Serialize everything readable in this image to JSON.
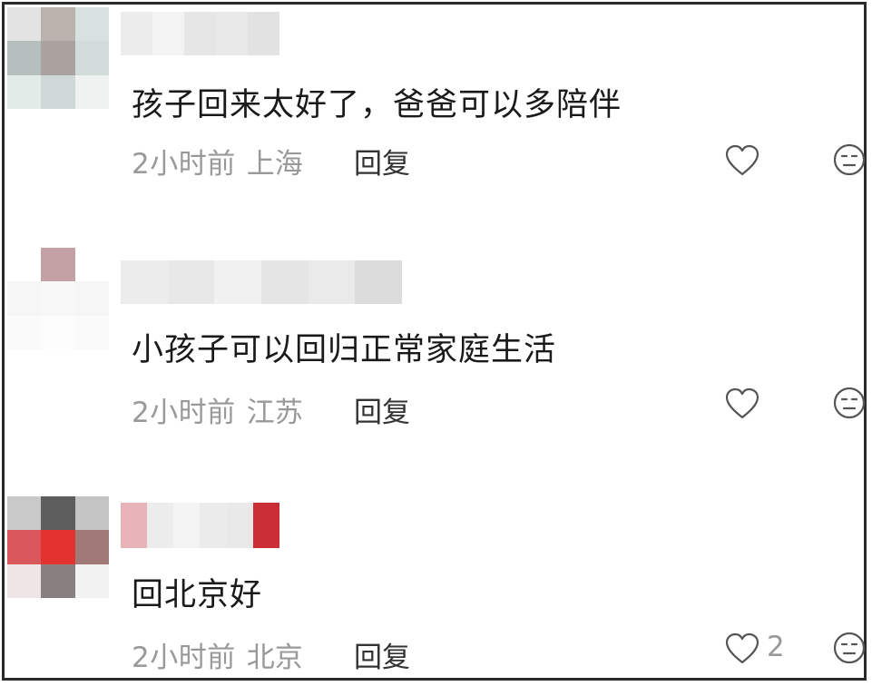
{
  "comments": [
    {
      "text": "孩子回来太好了，爸爸可以多陪伴",
      "time": "2小时前",
      "location": "上海",
      "reply_label": "回复",
      "like_count": "",
      "like_icon": "heart-outline-icon",
      "dislike_icon": "neutral-face-icon",
      "avatar_colors": [
        "#e3e3e3",
        "#b9b2ad",
        "#d9e0e0",
        "#b6bebe",
        "#a9a29e",
        "#d2dada",
        "#e3ebe8",
        "#cfd8d6",
        "#eef3f2"
      ],
      "name_colors": [
        "#ececec",
        "#f3f3f3",
        "#e6e6e6",
        "#e9e9e9",
        "#e2e2e2"
      ]
    },
    {
      "text": "小孩子可以回归正常家庭生活",
      "time": "2小时前",
      "location": "江苏",
      "reply_label": "回复",
      "like_count": "",
      "like_icon": "heart-outline-icon",
      "dislike_icon": "neutral-face-icon",
      "avatar_colors": [
        "#ffffff",
        "#c3a1a5",
        "#ffffff",
        "#f6f6f6",
        "#f8f8f8",
        "#f6f6f6",
        "#fafafa",
        "#fcfcfc",
        "#fafafa"
      ],
      "name_colors": [
        "#ececec",
        "#e8e8e8",
        "#f1f1f1",
        "#e5e5e5",
        "#eaeaea",
        "#dcdcdc"
      ]
    },
    {
      "text": "回北京好",
      "time": "2小时前",
      "location": "北京",
      "reply_label": "回复",
      "like_count": "2",
      "like_icon": "heart-outline-icon",
      "dislike_icon": "neutral-face-icon",
      "avatar_colors": [
        "#c9c9c9",
        "#5e5d5d",
        "#c5c5c5",
        "#d9585c",
        "#e2332f",
        "#a07a79",
        "#efe5e7",
        "#8a7f80",
        "#f2f2f2"
      ],
      "name_colors": [
        "#e7b3b8",
        "#ececec",
        "#f3f3f3",
        "#ebebeb",
        "#e9e9e9",
        "#cc2e35"
      ]
    }
  ]
}
